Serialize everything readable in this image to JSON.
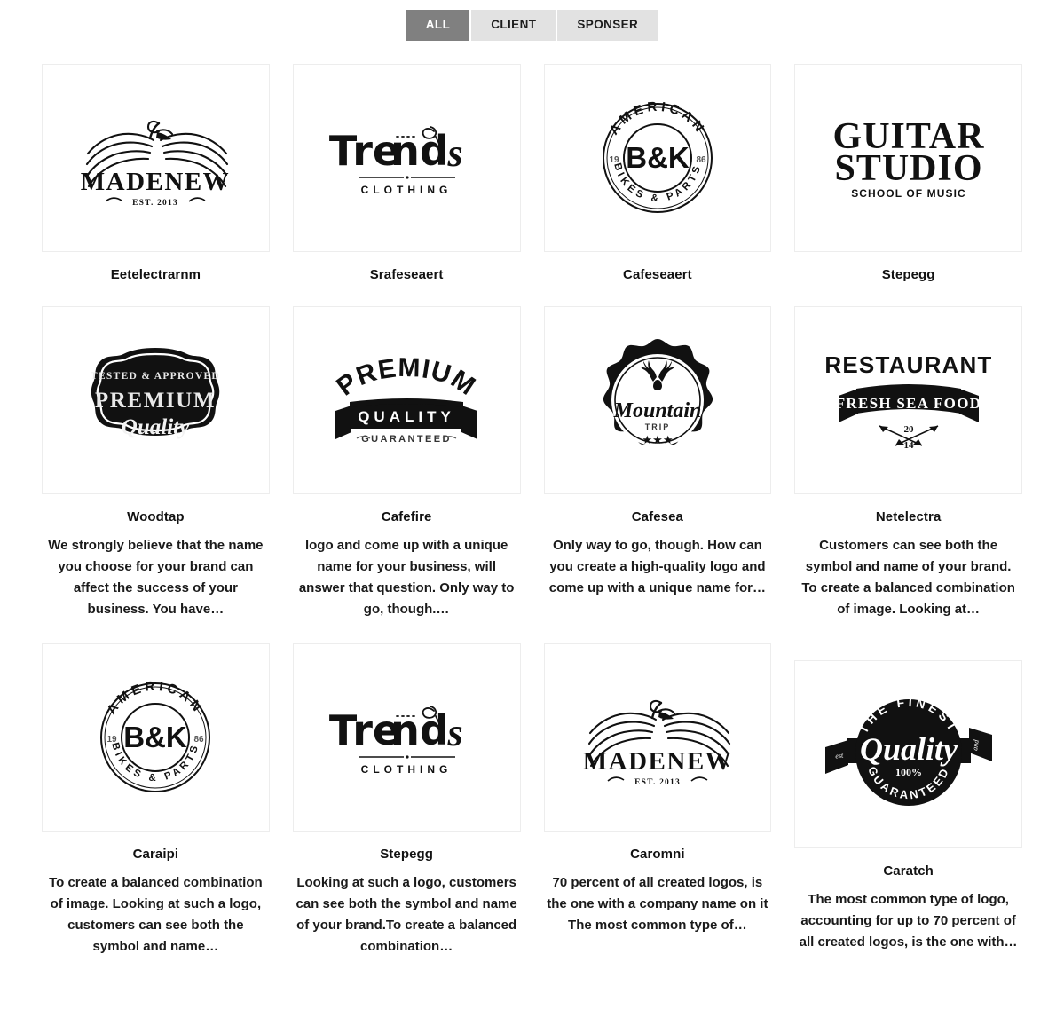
{
  "filters": {
    "buttons": [
      {
        "label": "ALL",
        "active": true
      },
      {
        "label": "CLIENT",
        "active": false
      },
      {
        "label": "SPONSER",
        "active": false
      }
    ],
    "active_color": "#808080",
    "inactive_color": "#e2e2e2"
  },
  "cards": [
    {
      "title": "Eetelectrarnm",
      "desc": "",
      "logo": "madenew-bird-logo",
      "logo_text": {
        "name": "MADENEW",
        "sub": "EST. 2013"
      }
    },
    {
      "title": "Srafeseaert",
      "desc": "",
      "logo": "trends-clothing-logo",
      "logo_text": {
        "name": "Trends",
        "sub": "CLOTHING"
      }
    },
    {
      "title": "Cafeseaert",
      "desc": "",
      "logo": "bk-american-bikes-badge-logo",
      "logo_text": {
        "top": "AMERICAN",
        "center": "B&K",
        "bottom": "BIKES & PARTS",
        "left": "19",
        "right": "86"
      }
    },
    {
      "title": "Stepegg",
      "desc": "",
      "logo": "guitar-studio-logo",
      "logo_text": {
        "line1": "GUITAR",
        "line2": "STUDIO",
        "sub": "SCHOOL OF MUSIC"
      }
    },
    {
      "title": "Woodtap",
      "desc": "We strongly believe that the name you choose for your brand can affect the success of your business. You have…",
      "logo": "premium-quality-ornate-badge-logo",
      "logo_text": {
        "top": "TESTED & APPROVED",
        "mid": "PREMIUM",
        "script": "Quality"
      }
    },
    {
      "title": "Cafefire",
      "desc": "logo and come up with a unique name for your business, will answer that question. Only way to go, though.…",
      "logo": "premium-quality-guaranteed-banner-logo",
      "logo_text": {
        "top": "PREMIUM",
        "banner": "QUALITY",
        "sub": "GUARANTEED"
      }
    },
    {
      "title": "Cafesea",
      "desc": "Only way to go, though. How can you create a high-quality logo and come up with a unique name for…",
      "logo": "mountain-trip-deer-badge-logo",
      "logo_text": {
        "script": "Mountain",
        "sub": "TRIP",
        "stars": "★★★"
      }
    },
    {
      "title": "Netelectra",
      "desc": "Customers can see both the symbol and name of your brand. To create a balanced combination of image. Looking at…",
      "logo": "restaurant-fresh-sea-food-logo",
      "logo_text": {
        "top": "RESTAURANT",
        "banner": "FRESH SEA FOOD",
        "year_top": "20",
        "year_bottom": "14"
      }
    },
    {
      "title": "Caraipi",
      "desc": "To create a balanced combination of image. Looking at such a logo, customers can see both the symbol and name…",
      "logo": "bk-american-bikes-badge-logo",
      "logo_text": {
        "top": "AMERICAN",
        "center": "B&K",
        "bottom": "BIKES & PARTS",
        "left": "19",
        "right": "86"
      }
    },
    {
      "title": "Stepegg",
      "desc": "Looking at such a logo, customers can see both the symbol and name of your brand.To create a balanced combination…",
      "logo": "trends-clothing-logo",
      "logo_text": {
        "name": "Trends",
        "sub": "CLOTHING"
      }
    },
    {
      "title": "Caromni",
      "desc": "70 percent of all created logos, is the one with a company name on it The most common type of…",
      "logo": "madenew-bird-logo",
      "logo_text": {
        "name": "MADENEW",
        "sub": "EST. 2013"
      }
    },
    {
      "title": "Caratch",
      "desc": "The most common type of logo, accounting for up to 70 percent of all created logos, is the one with…",
      "logo": "the-finest-quality-guaranteed-logo",
      "logo_text": {
        "top": "THE FINEST",
        "script": "Quality",
        "pct": "100%",
        "bottom": "GUARANTEED",
        "ribbon_left": "est",
        "ribbon_right": "and"
      }
    }
  ]
}
